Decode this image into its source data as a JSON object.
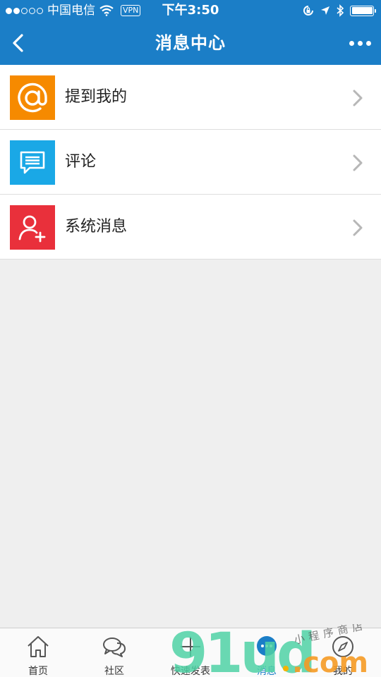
{
  "status": {
    "carrier": "中国电信",
    "vpn": "VPN",
    "time": "下午3:50",
    "signal_bars_filled": 2,
    "signal_bars_total": 5
  },
  "nav": {
    "title": "消息中心",
    "back_icon": "chevron-left-icon",
    "more_icon": "more-dots-icon"
  },
  "list": {
    "items": [
      {
        "label": "提到我的",
        "icon": "at-icon",
        "color": "#f68a00"
      },
      {
        "label": "评论",
        "icon": "comment-icon",
        "color": "#1aa8e6"
      },
      {
        "label": "系统消息",
        "icon": "add-user-icon",
        "color": "#e9303b"
      }
    ]
  },
  "tabbar": {
    "tabs": [
      {
        "label": "首页",
        "icon": "home-icon",
        "active": false
      },
      {
        "label": "社区",
        "icon": "chat-bubbles-icon",
        "active": false
      },
      {
        "label": "快速发表",
        "icon": "plus-icon",
        "active": false
      },
      {
        "label": "消息",
        "icon": "message-icon",
        "active": true
      },
      {
        "label": "我的",
        "icon": "compass-icon",
        "active": false
      }
    ]
  },
  "watermark": {
    "text_main": "91ud",
    "text_sub": ".com",
    "text_note": "小程序商店"
  },
  "colors": {
    "header": "#1b7ec7",
    "background": "#efefef",
    "active_tab": "#1b7ec7"
  }
}
